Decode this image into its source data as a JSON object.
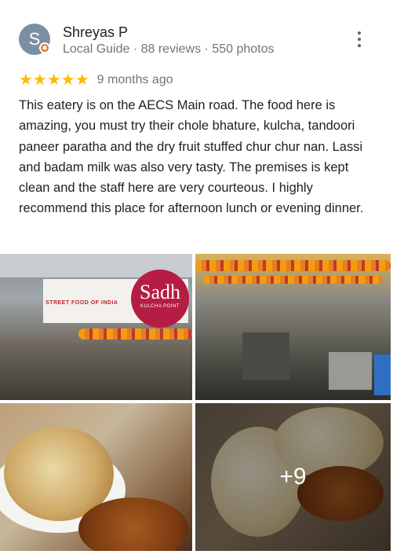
{
  "reviewer": {
    "initial": "S",
    "name": "Shreyas P",
    "meta": "Local Guide · 88 reviews · 550 photos",
    "avatar_color": "#7a8fa3",
    "badge_color": "#e8710a"
  },
  "rating": {
    "stars": 5,
    "stars_text": "★★★★★",
    "star_color": "#fbbc04",
    "age": "9 months ago"
  },
  "review_text": "This eatery is on the AECS Main road. The food here is amazing, you must try their chole bhature, kulcha, tandoori paneer paratha and the dry fruit stuffed chur chur nan. Lassi and badam milk was also very tasty. The premises is kept clean and the staff here are very courteous. I highly recommend this place for afternoon lunch or evening dinner.",
  "photos": {
    "photo1": {
      "sign_text": "STREET FOOD OF INDIA",
      "logo_main": "Sadh",
      "logo_sub": "KULCHA POINT"
    },
    "more_count": "+9"
  }
}
